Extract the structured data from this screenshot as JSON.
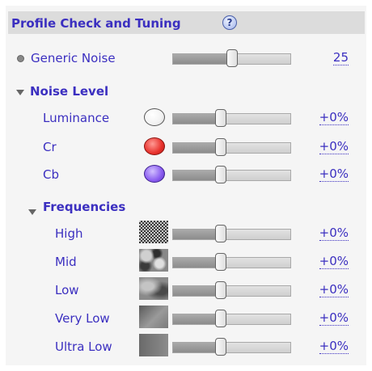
{
  "header": {
    "title": "Profile Check and Tuning",
    "help_glyph": "?"
  },
  "generic_noise": {
    "label": "Generic Noise",
    "value": "25",
    "level": 0.5
  },
  "noise_level": {
    "title": "Noise Level",
    "rows": [
      {
        "label": "Luminance",
        "value": "+0%",
        "level": 0.41,
        "swatch_color": "#ffffff"
      },
      {
        "label": "Cr",
        "value": "+0%",
        "level": 0.41,
        "swatch_color": "#e8312c"
      },
      {
        "label": "Cb",
        "value": "+0%",
        "level": 0.41,
        "swatch_color": "#8a5cf0"
      }
    ]
  },
  "frequencies": {
    "title": "Frequencies",
    "rows": [
      {
        "label": "High",
        "value": "+0%",
        "level": 0.41
      },
      {
        "label": "Mid",
        "value": "+0%",
        "level": 0.41
      },
      {
        "label": "Low",
        "value": "+0%",
        "level": 0.41
      },
      {
        "label": "Very Low",
        "value": "+0%",
        "level": 0.41
      },
      {
        "label": "Ultra Low",
        "value": "+0%",
        "level": 0.41
      }
    ]
  },
  "colors": {
    "accent": "#3b2fc0",
    "header_bg": "#dcdcdc",
    "panel_bg": "#f5f5f5"
  }
}
